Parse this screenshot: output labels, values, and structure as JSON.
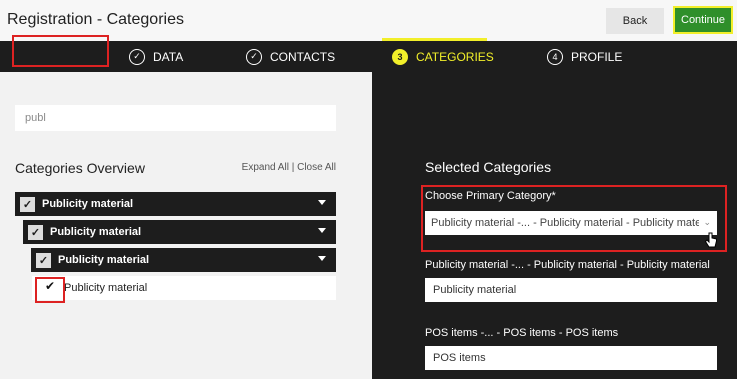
{
  "header": {
    "title": "Registration - Categories",
    "back_label": "Back",
    "continue_label": "Continue"
  },
  "steps": [
    {
      "label": "DATA",
      "icon": "check-circle-icon"
    },
    {
      "label": "CONTACTS",
      "icon": "check-circle-icon"
    },
    {
      "label": "CATEGORIES",
      "number": "3"
    },
    {
      "label": "PROFILE",
      "number": "4"
    }
  ],
  "left": {
    "search_value": "publ",
    "overview_title": "Categories Overview",
    "expand_all": "Expand All",
    "separator": "|",
    "close_all": "Close All",
    "tree": [
      {
        "label": "Publicity material",
        "checked": true
      },
      {
        "label": "Publicity material",
        "checked": true
      },
      {
        "label": "Publicity material",
        "checked": true
      },
      {
        "label": "Publicity material",
        "checked": true
      }
    ]
  },
  "right": {
    "title": "Selected Categories",
    "primary_label": "Choose Primary Category*",
    "primary_value": "Publicity material -... - Publicity material - Publicity mate...",
    "selected": [
      {
        "path": "Publicity material -... - Publicity material - Publicity material",
        "value": "Publicity material"
      },
      {
        "path": "POS items -... - POS items - POS items",
        "value": "POS items"
      }
    ]
  },
  "colors": {
    "accent_yellow": "#f2ef2a",
    "continue_green": "#2f8f2a",
    "dark": "#1d1d1d",
    "highlight_red": "#dd2222"
  }
}
